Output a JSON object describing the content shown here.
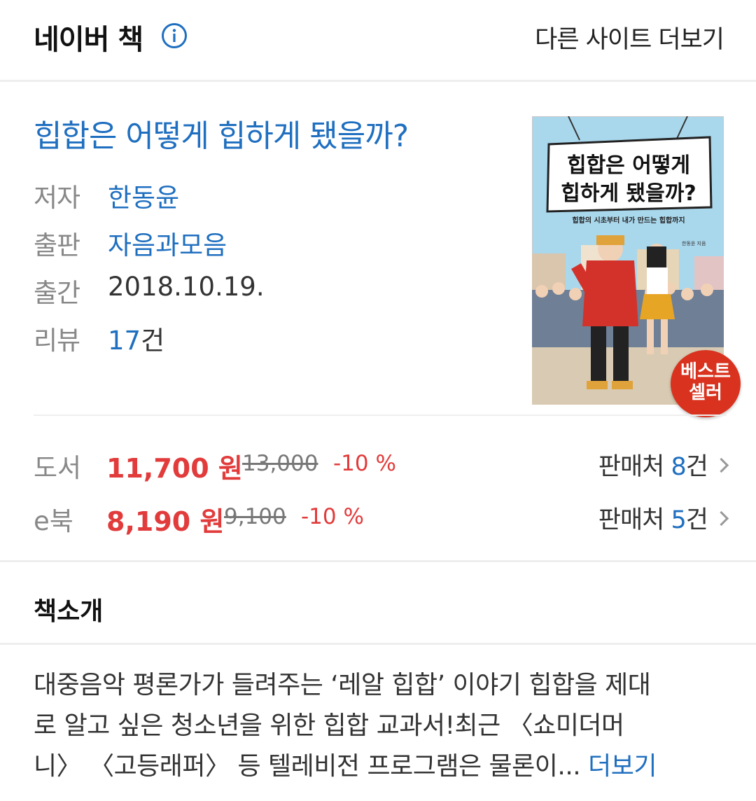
{
  "header": {
    "title": "네이버 책",
    "more_sites": "다른 사이트 더보기"
  },
  "book": {
    "title": "힙합은 어떻게 힙하게 됐을까?",
    "meta": [
      {
        "label": "저자",
        "value": "한동윤"
      },
      {
        "label": "출판",
        "value": "자음과모음"
      },
      {
        "label": "출간",
        "value": "2018.10.19."
      },
      {
        "label": "리뷰",
        "value_num": "17",
        "value_unit": "건"
      }
    ],
    "cover": {
      "title_line1": "힙합은 어떻게",
      "title_line2": "힙하게 됐을까?",
      "subtitle": "힙합의 시초부터 내가 만드는 힙합까지",
      "author": "한동윤 지음",
      "badge_line1": "베스트",
      "badge_line2": "셀러"
    }
  },
  "prices": [
    {
      "label": "도서",
      "price": "11,700",
      "unit": "원",
      "original": "13,000",
      "discount": "-10 %",
      "seller_label": "판매처",
      "seller_count": "8",
      "seller_unit": "건"
    },
    {
      "label": "e북",
      "price": "8,190",
      "unit": "원",
      "original": "9,100",
      "discount": "-10 %",
      "seller_label": "판매처",
      "seller_count": "5",
      "seller_unit": "건"
    }
  ],
  "intro": {
    "section_title": "책소개",
    "lines": [
      "대중음악 평론가가 들려주는 ‘레알 힙합’ 이야기 힙합을 제대",
      "로 알고 싶은 청소년을 위한 힙합 교과서!최근 〈쇼미더머",
      "니〉 〈고등래퍼〉 등 텔레비전 프로그램은 물론이..."
    ],
    "more_label": "더보기"
  },
  "colors": {
    "link": "#1f6fc0",
    "price": "#e23b3b",
    "badge": "#d9331f"
  }
}
